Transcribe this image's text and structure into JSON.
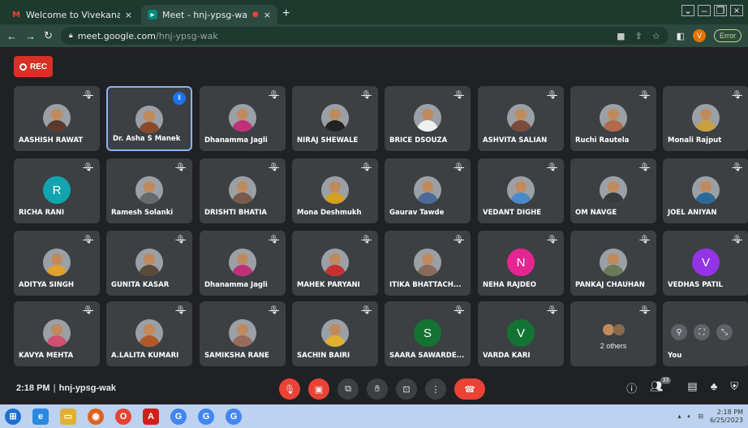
{
  "browser": {
    "tabs": [
      {
        "label": "Welcome to Vivekanand Educati...",
        "icon": "gmail-icon"
      },
      {
        "label": "Meet - hnj-ypsg-wak",
        "icon": "meet-icon"
      }
    ],
    "new_tab": "+",
    "url_domain": "meet.google.com",
    "url_path": "/hnj-ypsg-wak",
    "profile_letter": "V",
    "error_label": "Error"
  },
  "recording": {
    "label": "REC"
  },
  "participants": [
    {
      "name": "AASHISH RAWAT",
      "avatar": "photo",
      "color": "#5a3a2a"
    },
    {
      "name": "Dr. Asha S Manek",
      "avatar": "photo",
      "color": "#8a4a2a",
      "speaking": true
    },
    {
      "name": "Dhanamma Jagli",
      "avatar": "photo",
      "color": "#c0307a"
    },
    {
      "name": "NIRAJ SHEWALE",
      "avatar": "photo",
      "color": "#222222"
    },
    {
      "name": "BRICE DSOUZA",
      "avatar": "photo",
      "color": "#f0f0f0"
    },
    {
      "name": "ASHVITA SALIAN",
      "avatar": "photo",
      "color": "#7a4a3a"
    },
    {
      "name": "Ruchi Rautela",
      "avatar": "photo",
      "color": "#b06a4a"
    },
    {
      "name": "Monali Rajput",
      "avatar": "photo",
      "color": "#c8a040"
    },
    {
      "name": "RICHA RANI",
      "avatar": "letter",
      "letter": "R",
      "color": "#12a4af"
    },
    {
      "name": "Ramesh Solanki",
      "avatar": "photo",
      "color": "#6a6a6a"
    },
    {
      "name": "DRISHTI BHATIA",
      "avatar": "photo",
      "color": "#7a5a4a"
    },
    {
      "name": "Mona Deshmukh",
      "avatar": "photo",
      "color": "#d4a020"
    },
    {
      "name": "Gaurav Tawde",
      "avatar": "photo",
      "color": "#4a6a9a"
    },
    {
      "name": "VEDANT DIGHE",
      "avatar": "photo",
      "color": "#4a8aca"
    },
    {
      "name": "OM NAVGE",
      "avatar": "photo",
      "color": "#3a3a3a"
    },
    {
      "name": "JOEL ANIYAN",
      "avatar": "photo",
      "color": "#2a6a9a"
    },
    {
      "name": "ADITYA SINGH",
      "avatar": "photo",
      "color": "#e0a030"
    },
    {
      "name": "GUNITA KASAR",
      "avatar": "photo",
      "color": "#5a4a3a"
    },
    {
      "name": "Dhanamma Jagli",
      "avatar": "photo",
      "color": "#c0307a"
    },
    {
      "name": "MAHEK PARYANI",
      "avatar": "photo",
      "color": "#c83030"
    },
    {
      "name": "ITIKA BHATTACH...",
      "avatar": "photo",
      "color": "#8a6a5a"
    },
    {
      "name": "NEHA RAJDEO",
      "avatar": "letter",
      "letter": "N",
      "color": "#e52592"
    },
    {
      "name": "PANKAJ CHAUHAN",
      "avatar": "photo",
      "color": "#6a7a5a"
    },
    {
      "name": "VEDHAS PATIL",
      "avatar": "letter",
      "letter": "V",
      "color": "#9334e6"
    },
    {
      "name": "KAVYA MEHTA",
      "avatar": "photo",
      "color": "#d05070"
    },
    {
      "name": "A.LALITA KUMARI",
      "avatar": "photo",
      "color": "#b05a2a"
    },
    {
      "name": "SAMIKSHA RANE",
      "avatar": "photo",
      "color": "#9a6a5a"
    },
    {
      "name": "SACHIN BAIRI",
      "avatar": "photo",
      "color": "#e0b030"
    },
    {
      "name": "SAARA SAWARDE...",
      "avatar": "letter",
      "letter": "S",
      "color": "#137333"
    },
    {
      "name": "VARDA KARI",
      "avatar": "letter",
      "letter": "V",
      "color": "#137333"
    },
    {
      "name": "2 others",
      "avatar": "group",
      "color": "#5a5a5a"
    },
    {
      "name": "You",
      "avatar": "self",
      "color": "#3c4043"
    }
  ],
  "meeting": {
    "time": "2:18 PM",
    "code": "hnj-ypsg-wak",
    "participant_count": "33"
  },
  "taskbar": {
    "clock_time": "2:18 PM",
    "clock_date": "6/25/2023"
  }
}
